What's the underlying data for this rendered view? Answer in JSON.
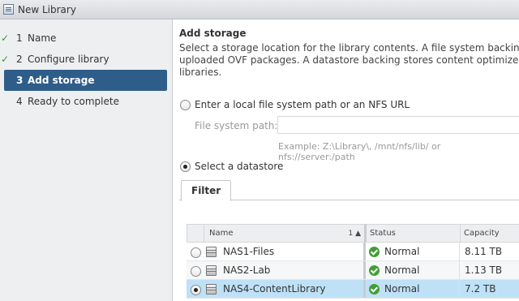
{
  "window": {
    "title": "New Library"
  },
  "steps": [
    {
      "num": "1",
      "label": "Name",
      "completed": true
    },
    {
      "num": "2",
      "label": "Configure library",
      "completed": true
    },
    {
      "num": "3",
      "label": "Add storage",
      "completed": false,
      "active": true
    },
    {
      "num": "4",
      "label": "Ready to complete",
      "completed": false
    }
  ],
  "main": {
    "heading": "Add storage",
    "description_lines": [
      "Select a storage location for the library contents. A file system backing is bes",
      "uploaded OVF packages. A datastore backing stores content optimized for cl",
      "libraries."
    ],
    "option_fs": {
      "label": "Enter a local file system path or an NFS URL",
      "selected": false
    },
    "fs_path": {
      "label": "File system path:",
      "value": "",
      "example": "Example: Z:\\Library\\, /mnt/nfs/lib/ or nfs://server:/path"
    },
    "option_ds": {
      "label": "Select a datastore",
      "selected": true
    },
    "tabs": [
      "Filter"
    ],
    "table": {
      "columns": {
        "name": "Name",
        "sort_indicator": "1 ▲",
        "status": "Status",
        "capacity": "Capacity"
      },
      "rows": [
        {
          "name": "NAS1-Files",
          "status": "Normal",
          "capacity": "8.11 TB",
          "selected": false
        },
        {
          "name": "NAS2-Lab",
          "status": "Normal",
          "capacity": "1.13 TB",
          "selected": false
        },
        {
          "name": "NAS4-ContentLibrary",
          "status": "Normal",
          "capacity": "7.2 TB",
          "selected": true
        }
      ]
    }
  },
  "colors": {
    "active_step": "#2f5d8a",
    "selected_row": "#bfe1f7",
    "status_ok": "#3f9f33",
    "check": "#3b9a2c"
  },
  "icons": {
    "app": "library-icon",
    "step_done": "checkmark-icon",
    "datastore": "datastore-icon",
    "status": "status-ok-icon"
  }
}
